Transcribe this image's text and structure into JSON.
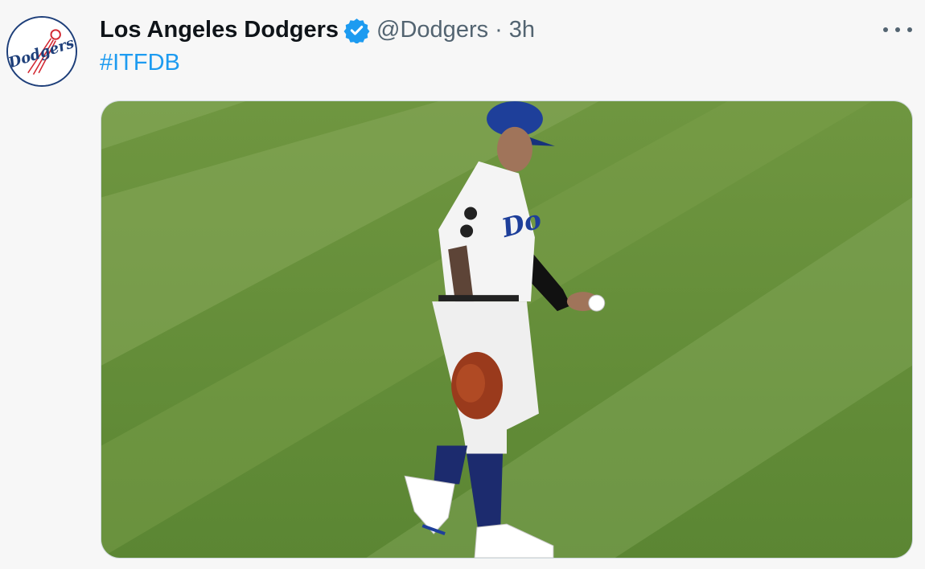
{
  "tweet": {
    "author": {
      "display_name": "Los Angeles Dodgers",
      "handle": "@Dodgers",
      "verified_icon": "verified-badge-icon",
      "avatar_logo_text": "Dodgers"
    },
    "separator": "·",
    "time": "3h",
    "text": "#ITFDB",
    "media": {
      "alt": "Dodgers infielder walking on the outfield grass holding a baseball and glove"
    },
    "more_icon": "more-options-icon"
  },
  "colors": {
    "link": "#1d9bf0",
    "secondary_text": "#536471",
    "primary_text": "#0f1419",
    "dodger_blue": "#1e3f7a",
    "grass_light": "#7fa14e",
    "grass_dark": "#5f8a36"
  }
}
